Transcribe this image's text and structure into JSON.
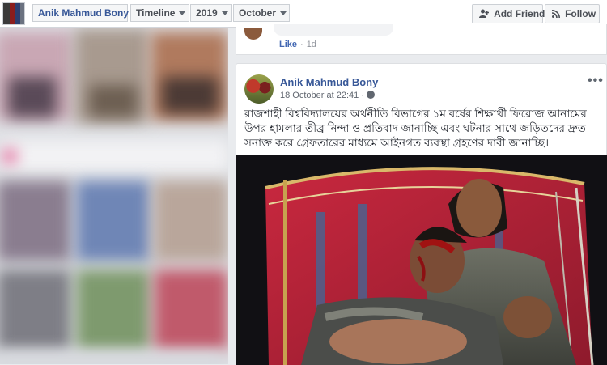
{
  "header": {
    "profile_name": "Anik Mahmud Bony",
    "section": "Timeline",
    "year": "2019",
    "month": "October",
    "add_friend_label": "Add Friend",
    "follow_label": "Follow"
  },
  "previous_post": {
    "like_label": "Like",
    "time_ago": "1d"
  },
  "post": {
    "author": "Anik Mahmud Bony",
    "timestamp": "18 October at 22:41",
    "text": "রাজশাহী বিশ্ববিদ্যালয়ের অর্থনীতি বিভাগের ১ম বর্ষের শিক্ষার্থী ফিরোজ আনামের উপর হামলার তীব্র নিন্দা ও প্রতিবাদ জানাচ্ছি এবং ঘটনার সাথে জড়িতদের দ্রুত সনাক্ত করে গ্রেফতারের মাধ্যমে আইনগত ব্যবস্থা গ্রহণের দাবী জানাচ্ছি।",
    "more_label": "•••"
  },
  "colors": {
    "link_blue": "#385898",
    "accent_blue": "#4267b2",
    "page_bg": "#e9ebee",
    "rickshaw_red": "#b3213a"
  },
  "icons": {
    "add_friend": "person-plus-icon",
    "follow": "rss-icon",
    "audience": "globe-icon",
    "dropdown": "caret-down-icon"
  }
}
